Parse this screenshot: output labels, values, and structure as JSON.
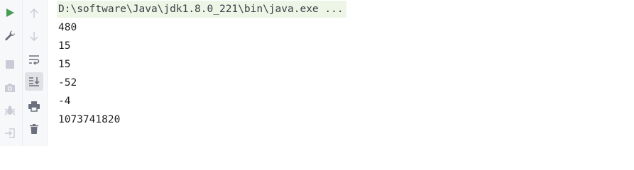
{
  "toolbar": {
    "left_buttons": [
      {
        "icon": "run-icon",
        "color": "#499c54"
      },
      {
        "icon": "wrench-icon",
        "color": "#6c707e"
      },
      {
        "icon": "stop-icon",
        "color": "#c9ccd6"
      },
      {
        "icon": "camera-icon",
        "color": "#c9ccd6"
      },
      {
        "icon": "debug-bug-icon",
        "color": "#c9ccd6"
      },
      {
        "icon": "exit-icon",
        "color": "#c9ccd6"
      }
    ],
    "right_buttons": [
      {
        "icon": "arrow-up-icon",
        "color": "#c9ccd6"
      },
      {
        "icon": "arrow-down-icon",
        "color": "#c9ccd6"
      },
      {
        "icon": "soft-wrap-icon",
        "color": "#6c707e"
      },
      {
        "icon": "scroll-to-end-icon",
        "color": "#6c707e",
        "active": true
      },
      {
        "icon": "print-icon",
        "color": "#6c707e"
      },
      {
        "icon": "trash-icon",
        "color": "#6c707e"
      }
    ]
  },
  "console": {
    "command": "D:\\software\\Java\\jdk1.8.0_221\\bin\\java.exe ...",
    "output": [
      "480",
      "15",
      "15",
      "-52",
      "-4",
      "1073741820"
    ]
  }
}
